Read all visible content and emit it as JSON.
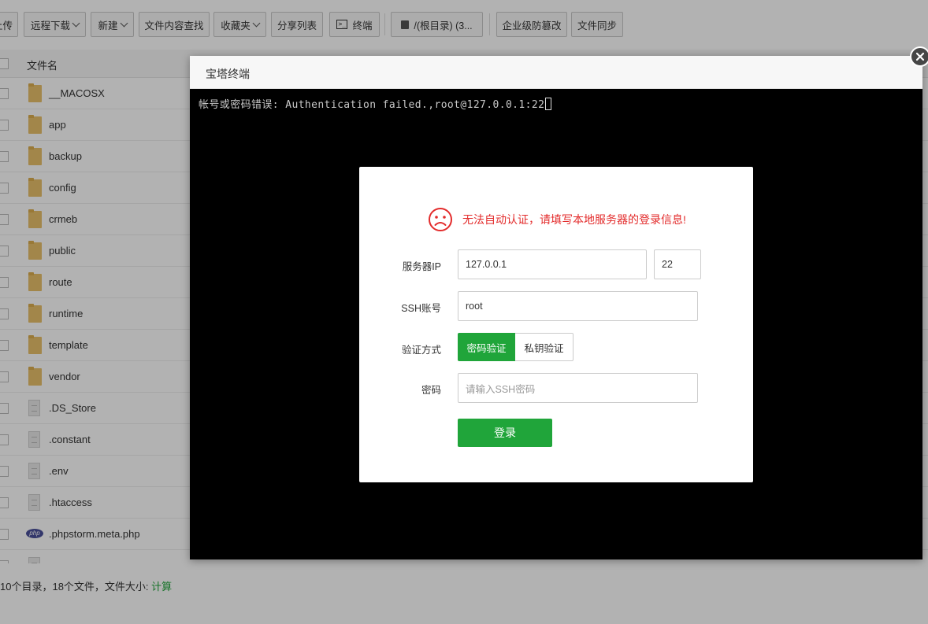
{
  "toolbar": {
    "buttons": [
      {
        "label": "上传",
        "caret": false
      },
      {
        "label": "远程下载",
        "caret": true
      },
      {
        "label": "新建",
        "caret": true
      },
      {
        "label": "文件内容查找",
        "caret": false
      },
      {
        "label": "收藏夹",
        "caret": true
      },
      {
        "label": "分享列表",
        "caret": false
      },
      {
        "label": "终端",
        "caret": false
      },
      {
        "label": "/(根目录) (3...",
        "caret": false
      },
      {
        "label": "企业级防篡改",
        "caret": false
      },
      {
        "label": "文件同步",
        "caret": false
      }
    ]
  },
  "file_list": {
    "header_name": "文件名",
    "rows": [
      {
        "name": "__MACOSX",
        "type": "folder"
      },
      {
        "name": "app",
        "type": "folder"
      },
      {
        "name": "backup",
        "type": "folder"
      },
      {
        "name": "config",
        "type": "folder"
      },
      {
        "name": "crmeb",
        "type": "folder"
      },
      {
        "name": "public",
        "type": "folder"
      },
      {
        "name": "route",
        "type": "folder"
      },
      {
        "name": "runtime",
        "type": "folder"
      },
      {
        "name": "template",
        "type": "folder"
      },
      {
        "name": "vendor",
        "type": "folder"
      },
      {
        "name": ".DS_Store",
        "type": "file"
      },
      {
        "name": ".constant",
        "type": "file"
      },
      {
        "name": ".env",
        "type": "file"
      },
      {
        "name": ".htaccess",
        "type": "file"
      },
      {
        "name": ".phpstorm.meta.php",
        "type": "php"
      }
    ]
  },
  "status_bar": {
    "summary": "10个目录，18个文件，文件大小: ",
    "calc_link": "计算"
  },
  "terminal": {
    "title": "宝塔终端",
    "output_line": "帐号或密码错误: Authentication failed.,root@127.0.0.1:22"
  },
  "login": {
    "warning": "无法自动认证，请填写本地服务器的登录信息!",
    "server_ip_label": "服务器IP",
    "server_ip_value": "127.0.0.1",
    "port_value": "22",
    "ssh_account_label": "SSH账号",
    "ssh_account_value": "root",
    "auth_method_label": "验证方式",
    "auth_password_option": "密码验证",
    "auth_key_option": "私钥验证",
    "password_label": "密码",
    "password_placeholder": "请输入SSH密码",
    "login_button": "登录"
  },
  "colors": {
    "accent_green": "#20a53a",
    "warning_red": "#e32b2b"
  }
}
